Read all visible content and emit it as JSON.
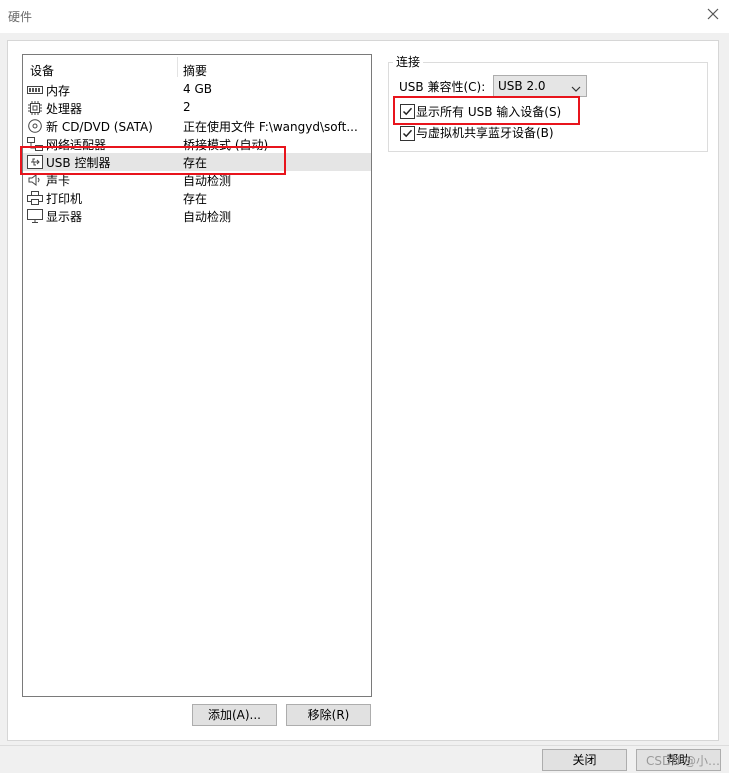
{
  "window": {
    "title": "硬件"
  },
  "device_list": {
    "columns": {
      "device": "设备",
      "summary": "摘要"
    },
    "rows": [
      {
        "name": "内存",
        "summary": "4 GB",
        "icon": "memory-icon"
      },
      {
        "name": "处理器",
        "summary": "2",
        "icon": "cpu-icon"
      },
      {
        "name": "新 CD/DVD (SATA)",
        "summary": "正在使用文件 F:\\wangyd\\soft...",
        "icon": "cd-dvd-icon"
      },
      {
        "name": "网络适配器",
        "summary": "桥接模式 (自动)",
        "icon": "network-adapter-icon"
      },
      {
        "name": "USB 控制器",
        "summary": "存在",
        "icon": "usb-icon"
      },
      {
        "name": "声卡",
        "summary": "自动检测",
        "icon": "sound-card-icon"
      },
      {
        "name": "打印机",
        "summary": "存在",
        "icon": "printer-icon"
      },
      {
        "name": "显示器",
        "summary": "自动检测",
        "icon": "display-icon"
      }
    ],
    "selected_index": 4
  },
  "buttons": {
    "add": "添加(A)...",
    "remove": "移除(R)",
    "close": "关闭",
    "help": "帮助"
  },
  "connection": {
    "group_label": "连接",
    "usb_compat_label": "USB 兼容性(C):",
    "usb_compat_value": "USB 2.0",
    "show_all_usb": {
      "label": "显示所有 USB 输入设备(S)",
      "checked": true
    },
    "share_bluetooth": {
      "label": "与虚拟机共享蓝牙设备(B)",
      "checked": true
    }
  },
  "watermark": "CSDN @小…",
  "colors": {
    "highlight": "#e8141c",
    "selected_row": "#e5e5e5"
  }
}
